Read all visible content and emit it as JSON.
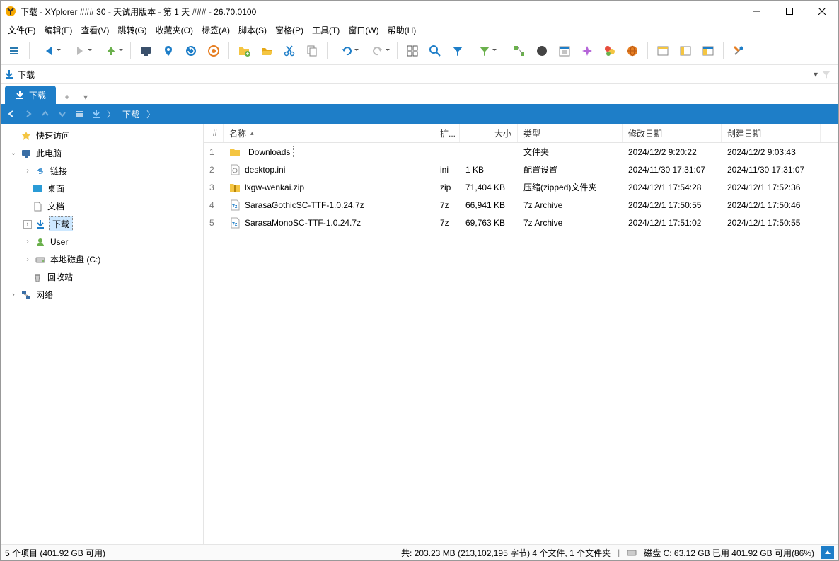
{
  "title": "下载 - XYplorer ### 30 - 天试用版本 - 第 1 天 ### - 26.70.0100",
  "menu": [
    "文件(F)",
    "编辑(E)",
    "查看(V)",
    "跳转(G)",
    "收藏夹(O)",
    "标签(A)",
    "脚本(S)",
    "窗格(P)",
    "工具(T)",
    "窗口(W)",
    "帮助(H)"
  ],
  "address": {
    "label": "下载"
  },
  "tab": {
    "label": "下载"
  },
  "breadcrumb": {
    "label": "下载"
  },
  "tree": {
    "quick": "快速访问",
    "pc": "此电脑",
    "links": "链接",
    "desktop": "桌面",
    "docs": "文档",
    "downloads": "下载",
    "user": "User",
    "diskc": "本地磁盘 (C:)",
    "recycle": "回收站",
    "network": "网络"
  },
  "columns": {
    "num": "#",
    "name": "名称",
    "ext": "扩...",
    "size": "大小",
    "type": "类型",
    "mod": "修改日期",
    "cre": "创建日期"
  },
  "rows": [
    {
      "n": "1",
      "name": "Downloads",
      "ext": "",
      "size": "",
      "type": "文件夹",
      "mod": "2024/12/2 9:20:22",
      "cre": "2024/12/2 9:03:43",
      "icon": "folder",
      "sel": true
    },
    {
      "n": "2",
      "name": "desktop.ini",
      "ext": "ini",
      "size": "1 KB",
      "type": "配置设置",
      "mod": "2024/11/30 17:31:07",
      "cre": "2024/11/30 17:31:07",
      "icon": "ini"
    },
    {
      "n": "3",
      "name": "lxgw-wenkai.zip",
      "ext": "zip",
      "size": "71,404 KB",
      "type": "压缩(zipped)文件夹",
      "mod": "2024/12/1 17:54:28",
      "cre": "2024/12/1 17:52:36",
      "icon": "zip"
    },
    {
      "n": "4",
      "name": "SarasaGothicSC-TTF-1.0.24.7z",
      "ext": "7z",
      "size": "66,941 KB",
      "type": "7z Archive",
      "mod": "2024/12/1 17:50:55",
      "cre": "2024/12/1 17:50:46",
      "icon": "7z"
    },
    {
      "n": "5",
      "name": "SarasaMonoSC-TTF-1.0.24.7z",
      "ext": "7z",
      "size": "69,763 KB",
      "type": "7z Archive",
      "mod": "2024/12/1 17:51:02",
      "cre": "2024/12/1 17:50:55",
      "icon": "7z"
    }
  ],
  "status": {
    "items": "5 个项目 (401.92 GB 可用)",
    "total": "共: 203.23 MB (213,102,195 字节)  4 个文件, 1 个文件夹",
    "disk": "磁盘 C:  63.12 GB 已用  401.92 GB 可用(86%)"
  }
}
